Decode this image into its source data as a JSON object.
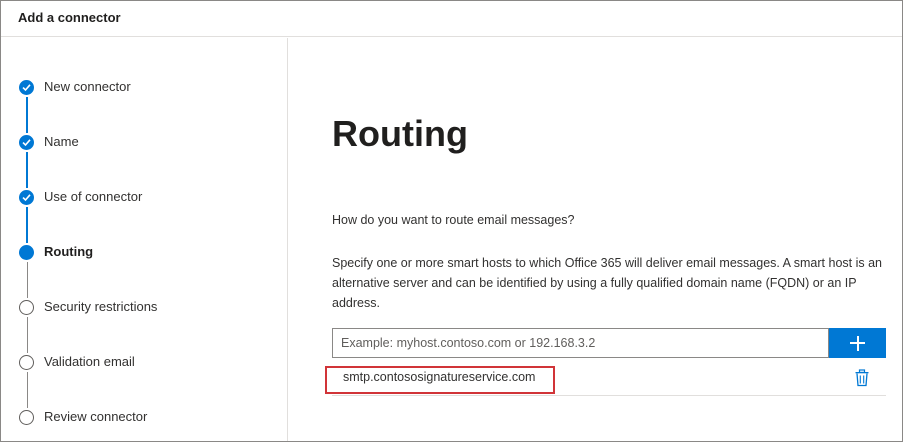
{
  "window": {
    "title": "Add a connector"
  },
  "steps": [
    {
      "label": "New connector",
      "state": "done"
    },
    {
      "label": "Name",
      "state": "done"
    },
    {
      "label": "Use of connector",
      "state": "done"
    },
    {
      "label": "Routing",
      "state": "current"
    },
    {
      "label": "Security restrictions",
      "state": "pending"
    },
    {
      "label": "Validation email",
      "state": "pending"
    },
    {
      "label": "Review connector",
      "state": "pending"
    }
  ],
  "main": {
    "heading": "Routing",
    "question": "How do you want to route email messages?",
    "description": "Specify one or more smart hosts to which Office 365 will deliver email messages. A smart host is an alternative server and can be identified by using a fully qualified domain name (FQDN) or an IP address.",
    "smart_host_input": {
      "value": "",
      "placeholder": "Example: myhost.contoso.com or 192.168.3.2"
    },
    "add_button_icon": "plus-icon",
    "smart_hosts": [
      {
        "host": "smtp.contososignatureservice.com",
        "delete_icon": "trash-icon"
      }
    ]
  },
  "colors": {
    "accent": "#0078d4",
    "highlight_border": "#d13438",
    "pending_step": "#605e5c"
  }
}
